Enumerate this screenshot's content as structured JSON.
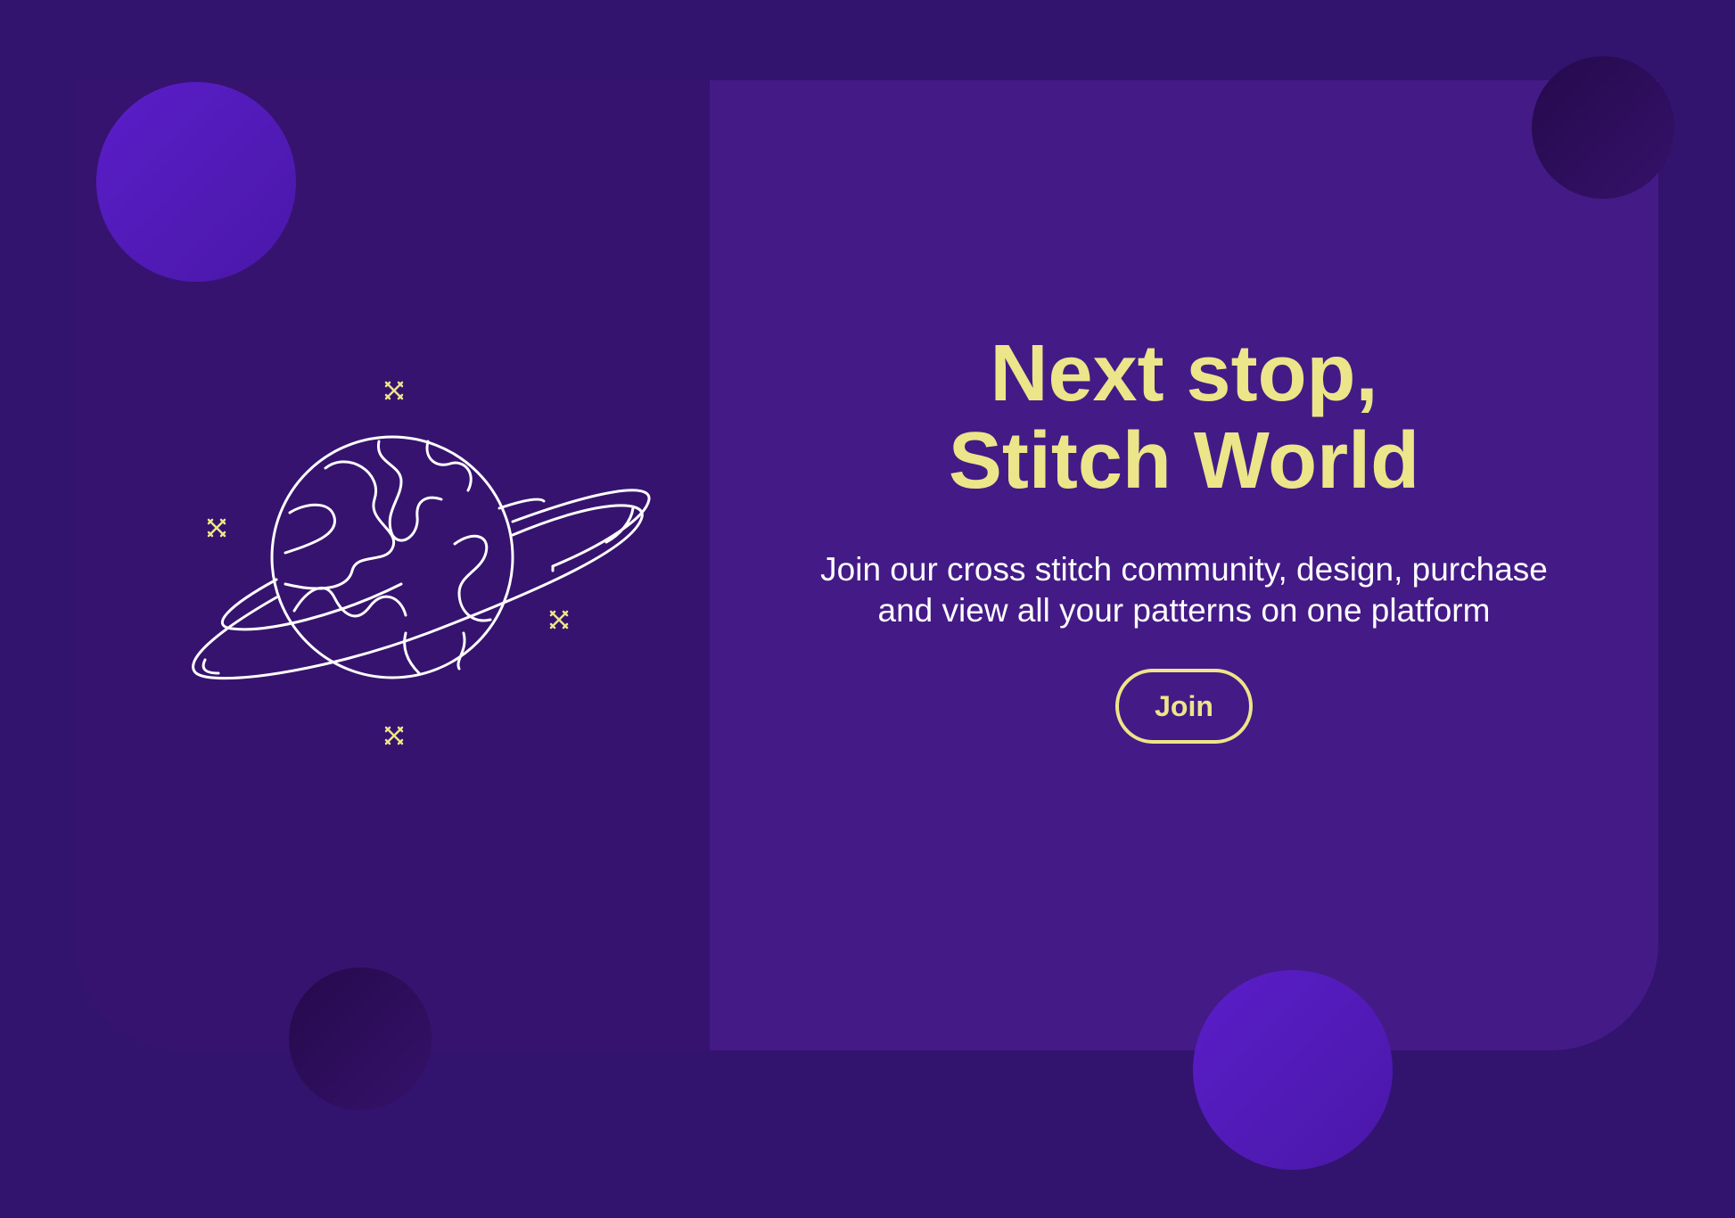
{
  "hero": {
    "headline_line1": "Next stop,",
    "headline_line2": "Stitch World",
    "subtitle_line1": "Join our cross stitch community, design, purchase",
    "subtitle_line2": "and view all your patterns on one platform",
    "join_label": "Join"
  },
  "illustration": {
    "icon": "planet-with-ring-icon",
    "sparkle_icon": "cross-stitch-star-icon"
  },
  "colors": {
    "background": "#32136e",
    "card_left": "#36136f",
    "card_right": "#441b86",
    "accent_yellow": "#ece589",
    "bubble_bright": "#5a1ec9",
    "bubble_dark": "#25094c",
    "text_white": "#ffffff"
  }
}
